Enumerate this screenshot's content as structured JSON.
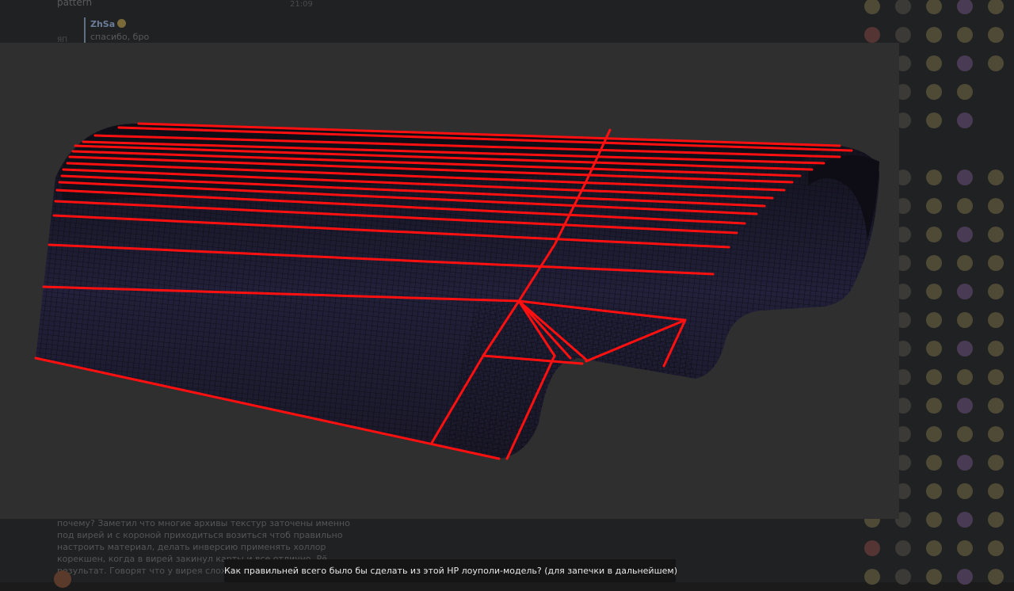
{
  "chat": {
    "top_message_text": "pattern",
    "top_message_time": "21:09",
    "reply_author": "ZhSa",
    "reply_text": "спасибо, бро",
    "avatar_label": "ЯП",
    "bottom_message_text": "почему? Заметил что многие архивы текстур заточены именно под вирей и с короной приходиться возиться чтоб правильно настроить материал, делать инверсию применять холлор корекшен, когда в вирей закинул карты и все отлично. Рё результат. Говорят что у вирея сложнее"
  },
  "viewer": {
    "caption": "Как правильней всего было бы сделать из этой HP лоуполи-модель? (для запечки в дальнейшем)",
    "accent_color": "#ff1010",
    "mesh_fill_color": "#1c1a2c",
    "background_color": "#2f2f30"
  },
  "emoji_panel": {
    "icon": "emoji-icon"
  }
}
